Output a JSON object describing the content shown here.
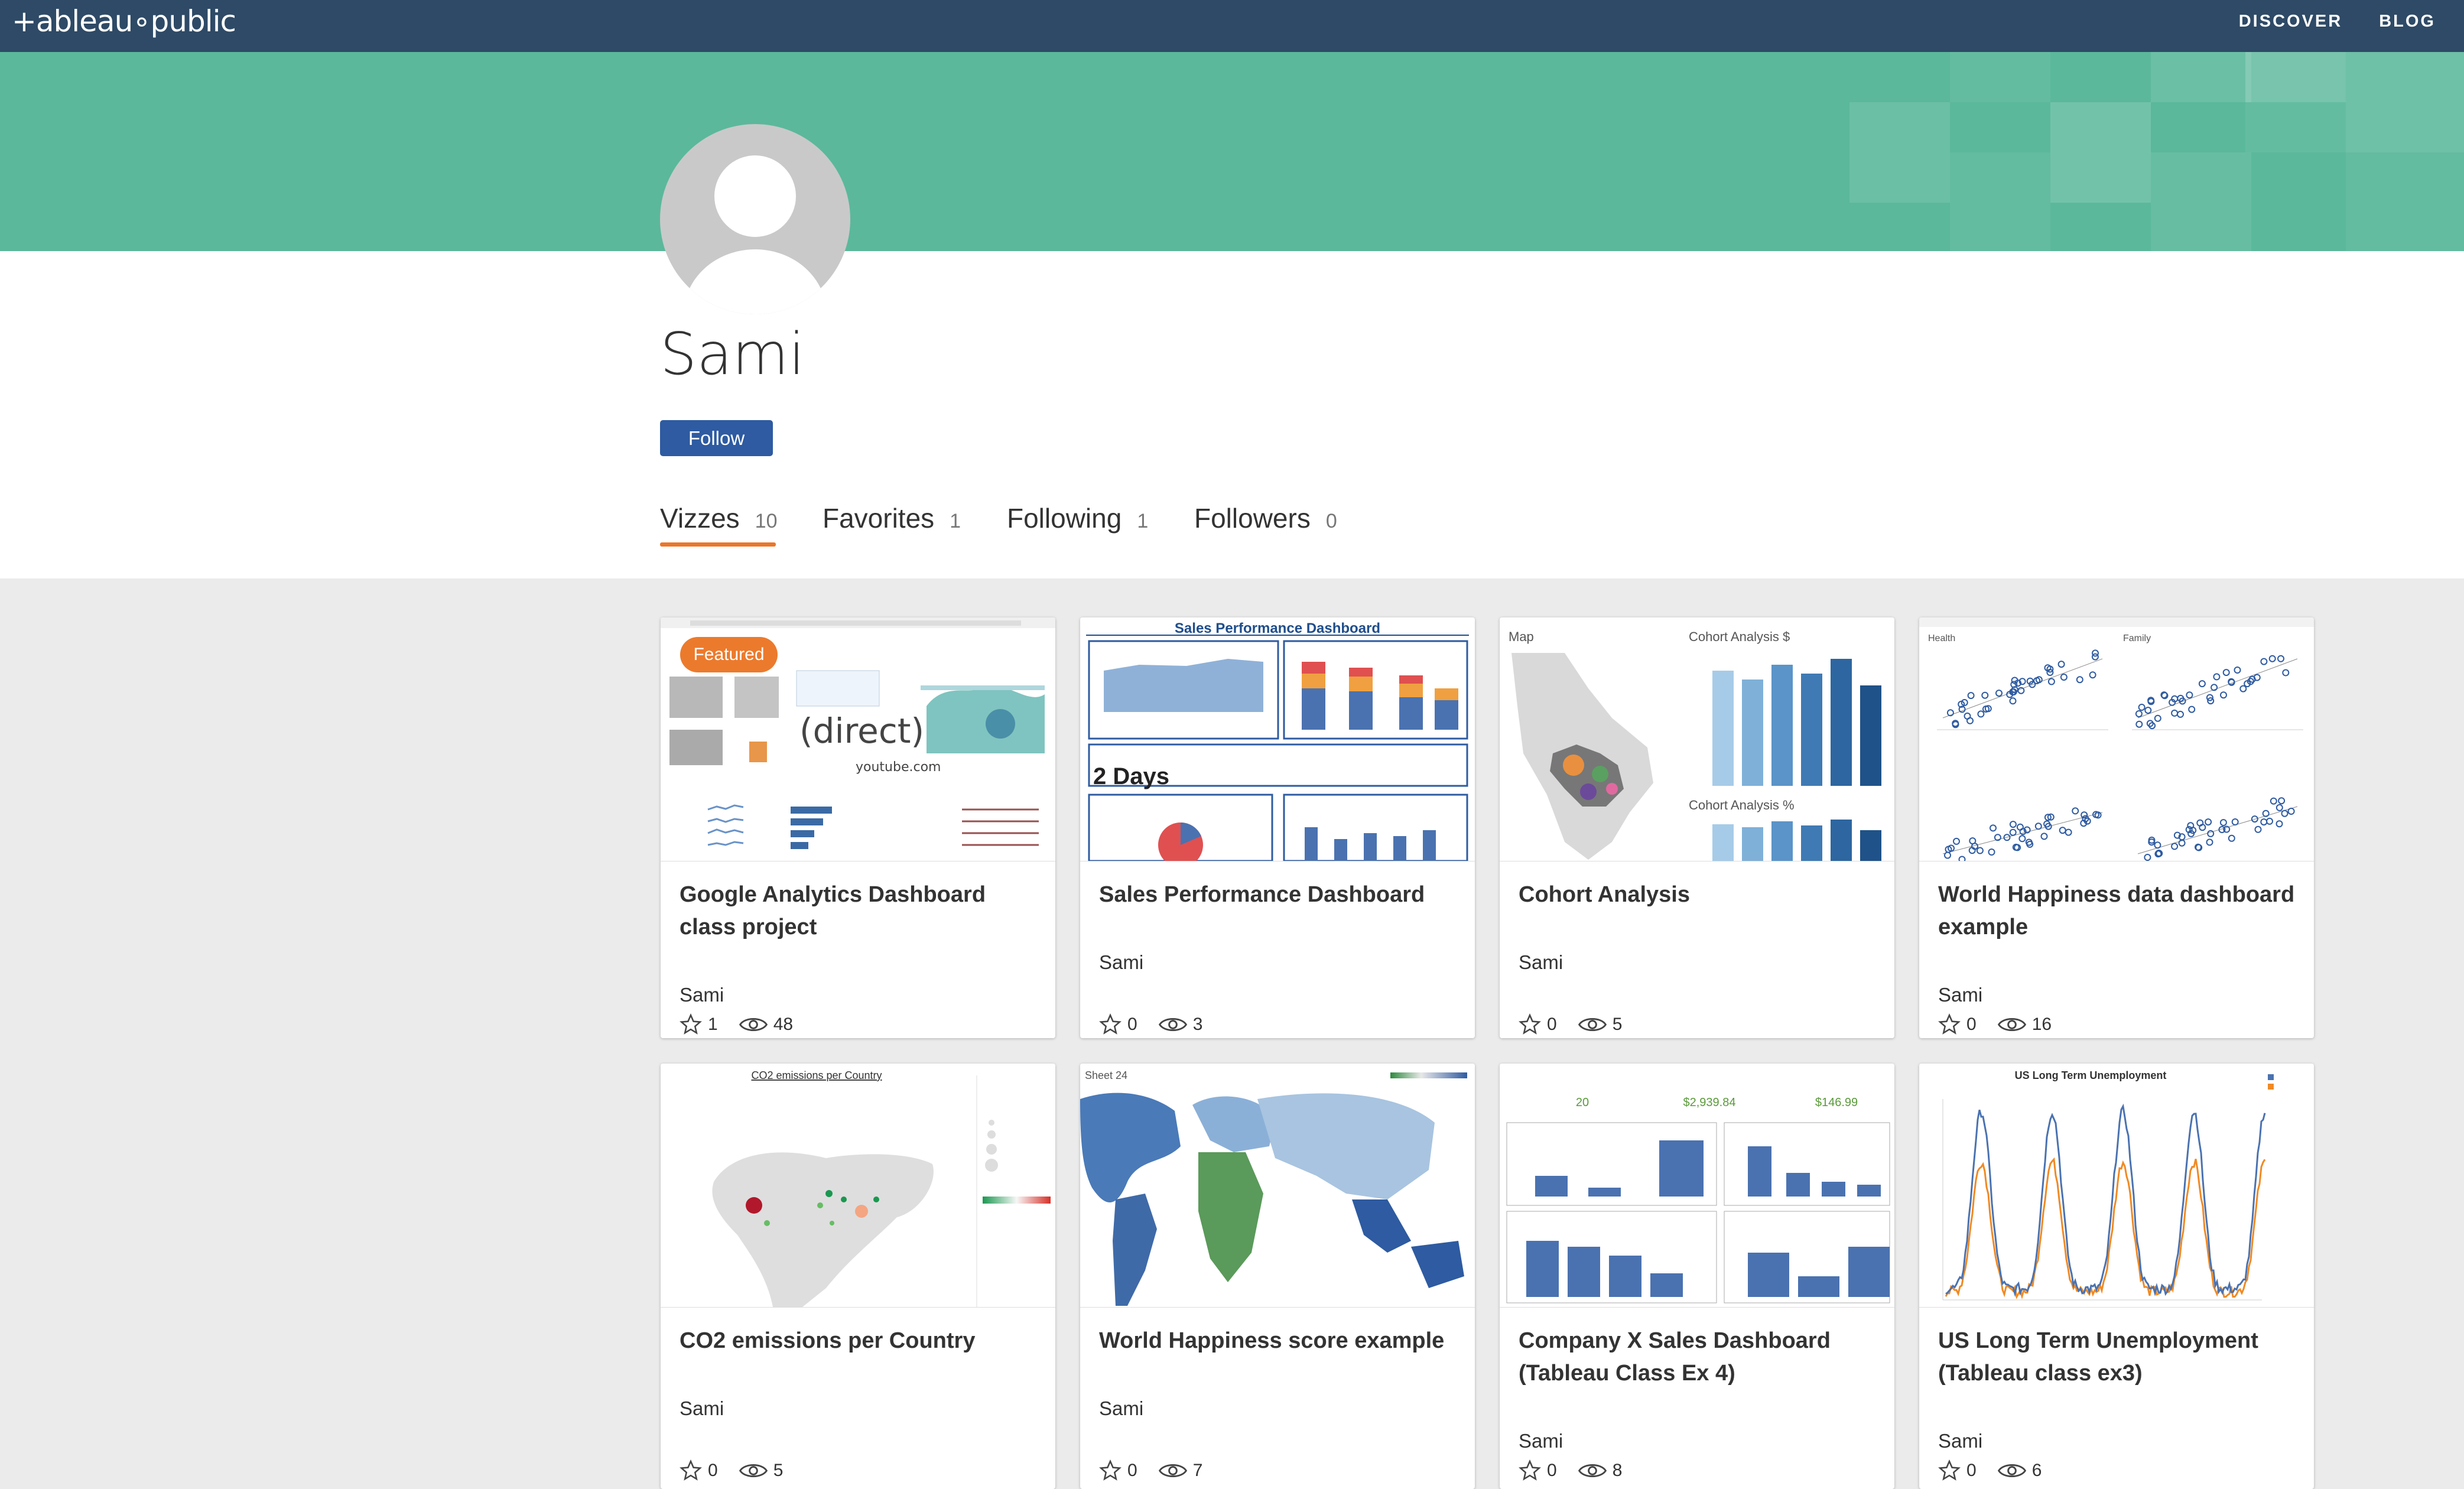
{
  "nav": {
    "logo": "+ableau∘public",
    "links": [
      "DISCOVER",
      "BLOG"
    ]
  },
  "profile": {
    "name": "Sami",
    "follow_label": "Follow"
  },
  "tabs": [
    {
      "label": "Vizzes",
      "count": "10"
    },
    {
      "label": "Favorites",
      "count": "1"
    },
    {
      "label": "Following",
      "count": "1"
    },
    {
      "label": "Followers",
      "count": "0"
    }
  ],
  "featured_label": "Featured",
  "cards": [
    {
      "title": "Google Analytics Dashboard class project",
      "author": "Sami",
      "favorites": "1",
      "views": "48",
      "thumb_text": "(direct)",
      "thumb_subtext": "youtube.com"
    },
    {
      "title": "Sales Performance Dashboard",
      "author": "Sami",
      "favorites": "0",
      "views": "3",
      "thumb_text": "Sales Performance Dashboard",
      "thumb_subtext": "2 Days"
    },
    {
      "title": "Cohort Analysis",
      "author": "Sami",
      "favorites": "0",
      "views": "5",
      "thumb_text": "Cohort Analysis $",
      "thumb_subtext": "Cohort Analysis %",
      "thumb_label": "Map"
    },
    {
      "title": "World Happiness data dashboard example",
      "author": "Sami",
      "favorites": "0",
      "views": "16",
      "thumb_text": "Health",
      "thumb_subtext": "Family"
    },
    {
      "title": "CO2 emissions per Country",
      "author": "Sami",
      "favorites": "0",
      "views": "5",
      "thumb_text": "CO2 emissions per Country"
    },
    {
      "title": "World Happiness score example",
      "author": "Sami",
      "favorites": "0",
      "views": "7",
      "thumb_text": "Sheet 24"
    },
    {
      "title": "Company X Sales Dashboard (Tableau Class Ex 4)",
      "author": "Sami",
      "favorites": "0",
      "views": "8",
      "thumb_text": "$2,939.84",
      "thumb_subtext": "$146.99",
      "thumb_label": "20"
    },
    {
      "title": "US Long Term Unemployment (Tableau class ex3)",
      "author": "Sami",
      "favorites": "0",
      "views": "6",
      "thumb_text": "US Long Term Unemployment"
    }
  ],
  "colors": {
    "nav_bg": "#2e4a66",
    "hero_bg": "#5bb89b",
    "accent_orange": "#e9762b",
    "follow_blue": "#2e5ba1"
  }
}
